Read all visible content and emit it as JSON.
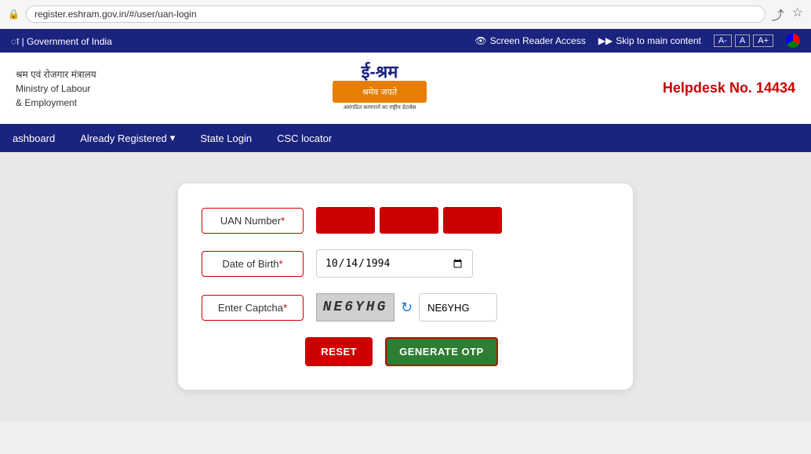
{
  "browser": {
    "url": "register.eshram.gov.in/#/user/uan-login",
    "lock_icon": "🔒",
    "share_icon": "⤴",
    "star_icon": "☆"
  },
  "top_bar": {
    "left_text": "ा | Government of India",
    "screen_reader": "Screen Reader Access",
    "skip_text": "Skip to main content",
    "font_a_minus": "A-",
    "font_a": "A",
    "font_a_plus": "A+"
  },
  "header": {
    "ministry_line1": "श्रम एवं रोजगार मंत्रालय",
    "ministry_line2": "Ministry of Labour",
    "ministry_line3": "& Employment",
    "helpdesk": "Helpdesk No. 14434",
    "logo_text_hindi": "ई-श्रम",
    "logo_tagline": "श्रमेव जयते",
    "logo_sub": "असंगठित कामगारों का राष्ट्रीय डेटाबेस"
  },
  "nav": {
    "items": [
      {
        "label": "ashboard",
        "has_dropdown": false
      },
      {
        "label": "Already Registered",
        "has_dropdown": true
      },
      {
        "label": "State Login",
        "has_dropdown": false
      },
      {
        "label": "CSC locator",
        "has_dropdown": false
      }
    ]
  },
  "form": {
    "uan_label": "UAN Number",
    "dob_label": "Date of Birth",
    "captcha_label": "Enter Captcha",
    "required_mark": "*",
    "dob_value": "10/14/1994",
    "captcha_image_text": "NE6YHG",
    "captcha_input_value": "NE6YHG",
    "reset_label": "RESET",
    "generate_label": "GENERATE OTP"
  }
}
